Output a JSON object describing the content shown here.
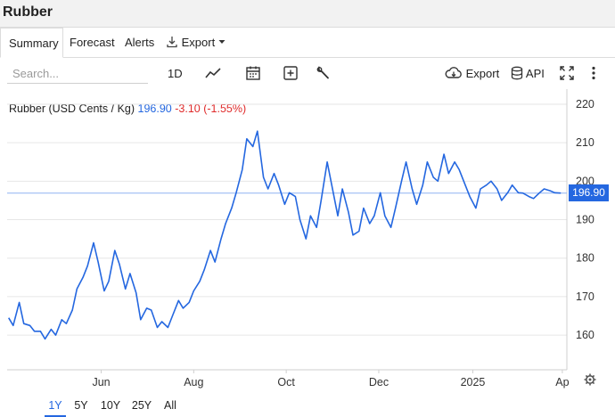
{
  "page": {
    "title": "Rubber"
  },
  "tabs": [
    {
      "label": "Summary"
    },
    {
      "label": "Forecast"
    },
    {
      "label": "Alerts"
    },
    {
      "label": "Export"
    }
  ],
  "toolbar": {
    "search_placeholder": "Search...",
    "period_label": "1D",
    "export_label": "Export",
    "api_label": "API"
  },
  "quote": {
    "name": "Rubber (USD Cents / Kg)",
    "price": "196.90",
    "change": "-3.10 (-1.55%)"
  },
  "ranges": [
    {
      "label": "1Y",
      "active": true
    },
    {
      "label": "5Y"
    },
    {
      "label": "10Y"
    },
    {
      "label": "25Y"
    },
    {
      "label": "All"
    }
  ],
  "colors": {
    "line": "#2467e0",
    "negative": "#e02b2b",
    "grid": "#e6e6e6"
  },
  "chart_data": {
    "type": "line",
    "title": "Rubber (USD Cents / Kg)",
    "series": [
      {
        "name": "Rubber",
        "x": [
          "2024-04-01",
          "2024-04-04",
          "2024-04-08",
          "2024-04-11",
          "2024-04-15",
          "2024-04-18",
          "2024-04-22",
          "2024-04-25",
          "2024-04-29",
          "2024-05-02",
          "2024-05-06",
          "2024-05-09",
          "2024-05-13",
          "2024-05-16",
          "2024-05-20",
          "2024-05-23",
          "2024-05-27",
          "2024-05-30",
          "2024-06-03",
          "2024-06-06",
          "2024-06-10",
          "2024-06-13",
          "2024-06-17",
          "2024-06-20",
          "2024-06-24",
          "2024-06-27",
          "2024-07-01",
          "2024-07-04",
          "2024-07-08",
          "2024-07-11",
          "2024-07-15",
          "2024-07-18",
          "2024-07-22",
          "2024-07-25",
          "2024-07-29",
          "2024-08-01",
          "2024-08-05",
          "2024-08-08",
          "2024-08-12",
          "2024-08-15",
          "2024-08-19",
          "2024-08-22",
          "2024-08-26",
          "2024-08-29",
          "2024-09-02",
          "2024-09-05",
          "2024-09-09",
          "2024-09-12",
          "2024-09-16",
          "2024-09-19",
          "2024-09-23",
          "2024-09-26",
          "2024-09-30",
          "2024-10-03",
          "2024-10-07",
          "2024-10-10",
          "2024-10-14",
          "2024-10-17",
          "2024-10-21",
          "2024-10-24",
          "2024-10-28",
          "2024-10-31",
          "2024-11-04",
          "2024-11-07",
          "2024-11-11",
          "2024-11-14",
          "2024-11-18",
          "2024-11-21",
          "2024-11-25",
          "2024-11-28",
          "2024-12-02",
          "2024-12-05",
          "2024-12-09",
          "2024-12-12",
          "2024-12-16",
          "2024-12-19",
          "2024-12-23",
          "2024-12-26",
          "2024-12-30",
          "2025-01-02",
          "2025-01-06",
          "2025-01-09",
          "2025-01-13",
          "2025-01-16",
          "2025-01-20",
          "2025-01-23",
          "2025-01-27",
          "2025-01-30",
          "2025-02-03",
          "2025-02-06",
          "2025-02-10",
          "2025-02-13",
          "2025-02-17",
          "2025-02-20",
          "2025-02-24",
          "2025-02-27",
          "2025-03-03",
          "2025-03-06",
          "2025-03-10",
          "2025-03-13",
          "2025-03-17",
          "2025-03-20",
          "2025-03-24",
          "2025-03-27",
          "2025-03-31"
        ],
        "values": [
          164.5,
          162.5,
          168.5,
          163,
          162.5,
          161,
          161,
          159,
          161.5,
          160,
          164,
          163,
          166.5,
          172,
          175,
          178,
          184,
          179,
          171.5,
          174,
          182,
          178.5,
          172,
          176,
          171,
          164,
          167,
          166.5,
          162,
          163.5,
          162,
          165,
          169,
          167,
          168.5,
          171.5,
          174,
          177,
          182,
          179,
          185,
          189,
          193,
          197,
          203,
          211,
          209,
          213,
          201,
          198,
          202,
          199,
          194,
          197,
          196,
          190,
          185,
          191,
          188,
          195,
          205,
          199,
          191,
          198,
          192,
          186,
          187,
          193,
          189,
          191,
          197,
          191,
          188,
          193,
          200,
          205,
          198,
          194,
          199,
          205,
          201,
          200,
          207,
          202,
          205,
          203,
          199,
          196,
          193,
          198,
          199,
          200,
          198,
          195,
          197,
          199,
          197,
          196.9,
          196,
          195.5,
          197,
          198,
          197.5,
          197,
          196.9
        ]
      }
    ],
    "xtick_labels": [
      "Jun",
      "Aug",
      "Oct",
      "Dec",
      "2025",
      "Ap"
    ],
    "yticks": [
      160,
      170,
      180,
      190,
      200,
      210,
      220
    ],
    "ylim": [
      151,
      223
    ],
    "last_value": 196.9,
    "grid": true
  }
}
